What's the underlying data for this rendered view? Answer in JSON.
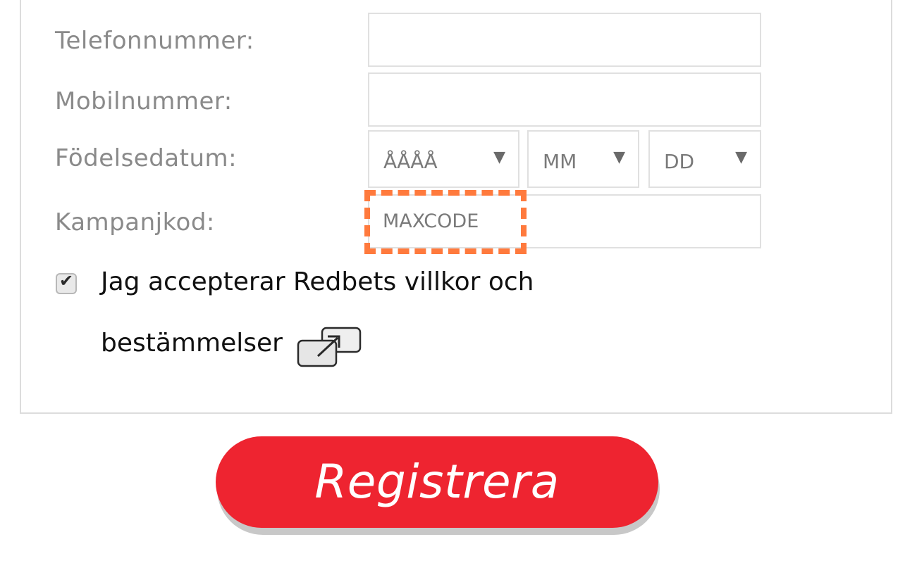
{
  "form": {
    "phone_label": "Telefonnummer:",
    "phone_value": "",
    "mobile_label": "Mobilnummer:",
    "mobile_value": "",
    "birthdate_label": "Födelsedatum:",
    "birth_year_selected": "ÅÅÅÅ",
    "birth_month_selected": "MM",
    "birth_day_selected": "DD",
    "campaign_label": "Kampanjkod:",
    "campaign_value": "MAXCODE"
  },
  "terms": {
    "checked": true,
    "line1": "Jag accepterar Redbets villkor och",
    "line2": "bestämmelser"
  },
  "actions": {
    "register_label": "Registrera"
  },
  "colors": {
    "accent": "#ee2430",
    "highlight": "#ff7a3d",
    "label": "#8a8a8a",
    "border": "#e0e0e0"
  },
  "icons": {
    "dropdown": "dropdown-arrow-icon",
    "external": "external-link-icon",
    "check": "checkmark-icon"
  }
}
